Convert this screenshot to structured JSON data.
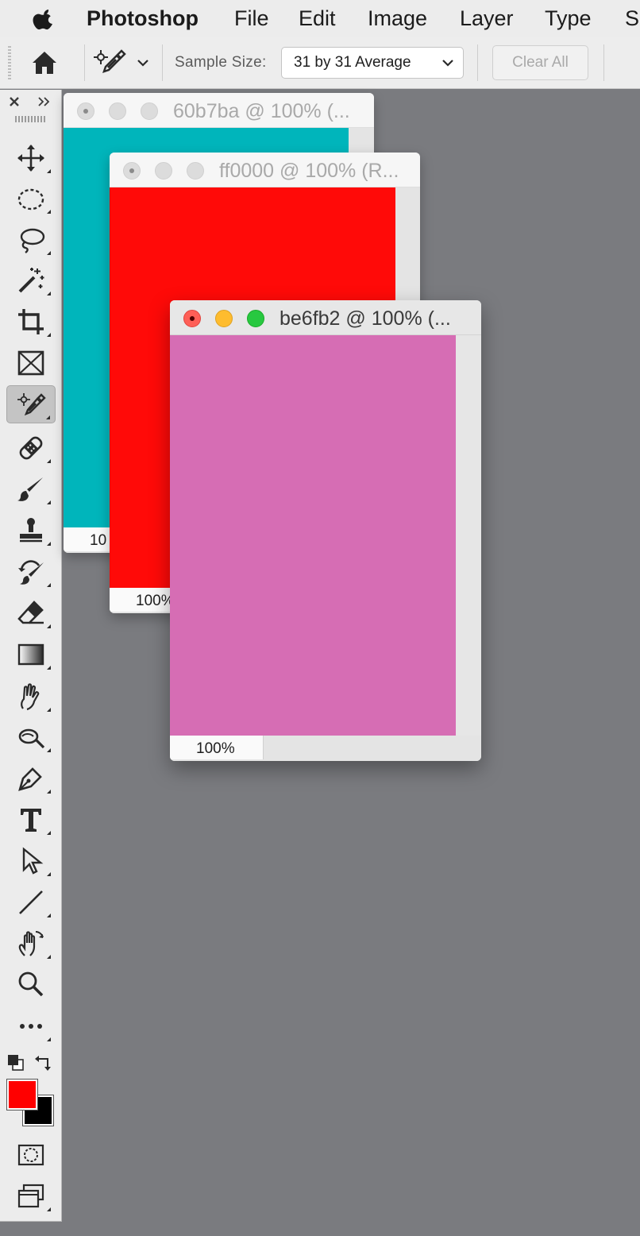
{
  "menubar": {
    "app_name": "Photoshop",
    "items": [
      "File",
      "Edit",
      "Image",
      "Layer",
      "Type",
      "Se"
    ]
  },
  "options_bar": {
    "tool_icon": "color-sampler-icon",
    "sample_size_label": "Sample Size:",
    "sample_size_value": "31 by 31 Average",
    "clear_all_label": "Clear All"
  },
  "toolbar": {
    "tools": [
      "move",
      "marquee",
      "lasso",
      "magic-wand",
      "crop",
      "frame",
      "color-sampler",
      "healing",
      "brush",
      "clone-stamp",
      "history-brush",
      "eraser",
      "gradient",
      "smudge",
      "dodge",
      "pen",
      "type",
      "path-selection",
      "line",
      "hand",
      "zoom",
      "edit-toolbar"
    ],
    "active_tool": "color-sampler",
    "foreground_color": "#ff0000",
    "background_color": "#000000"
  },
  "windows": [
    {
      "title": "60b7ba @ 100% (...",
      "color": "#00b5bb",
      "zoom": "10",
      "state": "inactive"
    },
    {
      "title": "ff0000 @ 100% (R...",
      "color": "#ff0a08",
      "zoom": "100%",
      "state": "inactive"
    },
    {
      "title": "be6fb2 @ 100% (...",
      "color": "#d66db4",
      "zoom": "100%",
      "state": "active"
    }
  ],
  "colors": {
    "traffic_close": "#fe5f57",
    "traffic_minimize": "#febc2e",
    "traffic_zoom": "#28c840",
    "desktop": "#7a7b7f"
  }
}
